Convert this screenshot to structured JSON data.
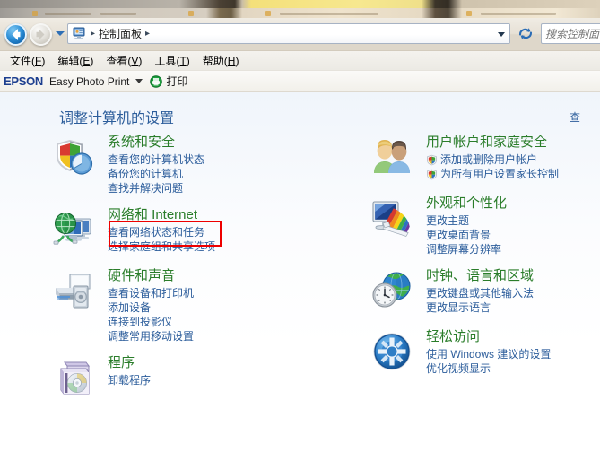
{
  "window": {
    "nav": {
      "back_icon": "back-arrow-icon",
      "forward_icon": "forward-arrow-icon",
      "recent_pages_icon": "chevron-down-icon",
      "breadcrumb_icon": "control-panel-icon",
      "breadcrumb": "控制面板",
      "separator": "▸",
      "dropdown_icon": "chevron-down-icon",
      "refresh_icon": "refresh-icon"
    },
    "search": {
      "placeholder": "搜索控制面",
      "value": "",
      "icon": "search-icon"
    },
    "menubar": [
      {
        "name": "file",
        "text": "文件",
        "mnemonic": "F"
      },
      {
        "name": "edit",
        "text": "编辑",
        "mnemonic": "E"
      },
      {
        "name": "view",
        "text": "查看",
        "mnemonic": "V"
      },
      {
        "name": "tools",
        "text": "工具",
        "mnemonic": "T"
      },
      {
        "name": "help",
        "text": "帮助",
        "mnemonic": "H"
      }
    ],
    "epson_toolbar": {
      "logo": "EPSON",
      "product": "Easy Photo Print",
      "dropdown_icon": "chevron-down-icon",
      "print_icon": "epson-print-icon",
      "print_label": "打印"
    }
  },
  "content": {
    "page_title": "调整计算机的设置",
    "view_by_label": "查",
    "columns": {
      "left": [
        {
          "id": "system-and-security",
          "icon": "security-shield-icon",
          "title": "系统和安全",
          "highlighted": true,
          "links": [
            {
              "text": "查看您的计算机状态",
              "shield": false
            },
            {
              "text": "备份您的计算机",
              "shield": false
            },
            {
              "text": "查找并解决问题",
              "shield": false
            }
          ]
        },
        {
          "id": "network-and-internet",
          "icon": "network-globe-icon",
          "title": "网络和 Internet",
          "highlighted": false,
          "links": [
            {
              "text": "查看网络状态和任务",
              "shield": false
            },
            {
              "text": "选择家庭组和共享选项",
              "shield": false
            }
          ]
        },
        {
          "id": "hardware-and-sound",
          "icon": "printer-speaker-icon",
          "title": "硬件和声音",
          "highlighted": false,
          "links": [
            {
              "text": "查看设备和打印机",
              "shield": false
            },
            {
              "text": "添加设备",
              "shield": false
            },
            {
              "text": "连接到投影仪",
              "shield": false
            },
            {
              "text": "调整常用移动设置",
              "shield": false
            }
          ]
        },
        {
          "id": "programs",
          "icon": "programs-box-icon",
          "title": "程序",
          "highlighted": false,
          "links": [
            {
              "text": "卸载程序",
              "shield": false
            }
          ]
        }
      ],
      "right": [
        {
          "id": "user-accounts-and-family-safety",
          "icon": "user-accounts-icon",
          "title": "用户帐户和家庭安全",
          "highlighted": false,
          "links": [
            {
              "text": "添加或删除用户帐户",
              "shield": true
            },
            {
              "text": "为所有用户设置家长控制",
              "shield": true
            }
          ]
        },
        {
          "id": "appearance-and-personalization",
          "icon": "appearance-monitor-icon",
          "title": "外观和个性化",
          "highlighted": false,
          "links": [
            {
              "text": "更改主题",
              "shield": false
            },
            {
              "text": "更改桌面背景",
              "shield": false
            },
            {
              "text": "调整屏幕分辨率",
              "shield": false
            }
          ]
        },
        {
          "id": "clock-language-and-region",
          "icon": "clock-globe-icon",
          "title": "时钟、语言和区域",
          "highlighted": false,
          "links": [
            {
              "text": "更改键盘或其他输入法",
              "shield": false
            },
            {
              "text": "更改显示语言",
              "shield": false
            }
          ]
        },
        {
          "id": "ease-of-access",
          "icon": "ease-of-access-icon",
          "title": "轻松访问",
          "highlighted": false,
          "links": [
            {
              "text": "使用 Windows 建议的设置",
              "shield": false
            },
            {
              "text": "优化视频显示",
              "shield": false
            }
          ]
        }
      ]
    }
  },
  "colors": {
    "category_title": "#2a7d2a",
    "link": "#2c5d9b",
    "page_title": "#2c5d9b",
    "highlight_rect": "#ee0000",
    "epson_logo": "#1d3f8f"
  }
}
